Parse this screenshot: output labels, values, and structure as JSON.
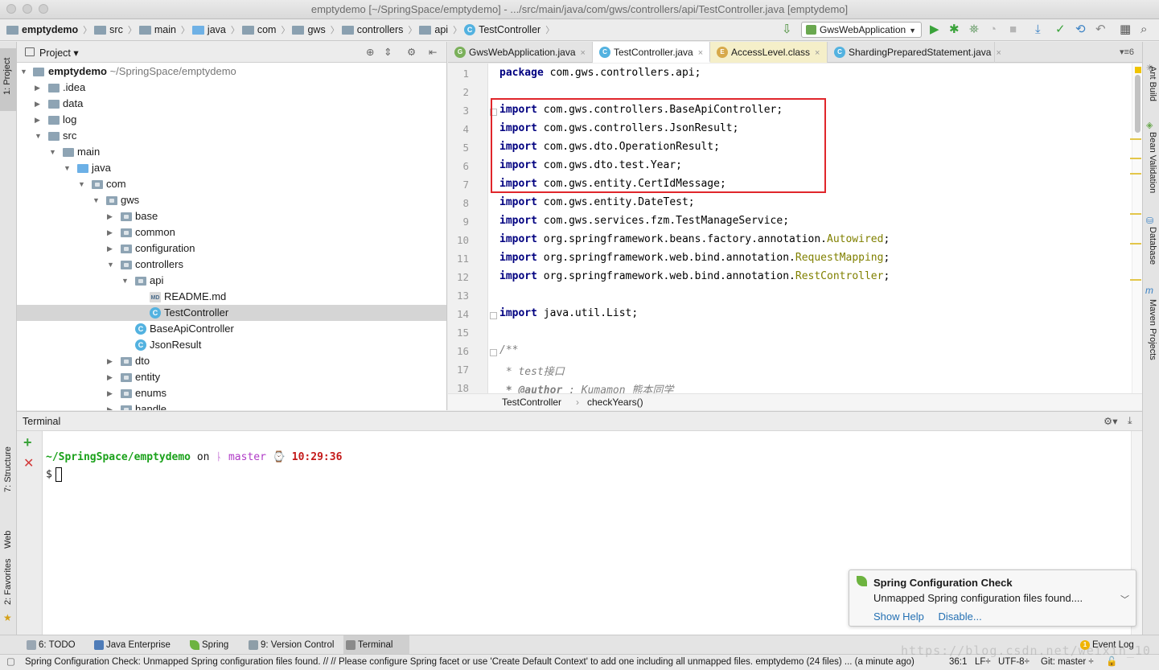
{
  "window": {
    "title": "emptydemo [~/SpringSpace/emptydemo] - .../src/main/java/com/gws/controllers/api/TestController.java [emptydemo]"
  },
  "breadcrumbs": [
    "emptydemo",
    "src",
    "main",
    "java",
    "com",
    "gws",
    "controllers",
    "api",
    "TestController"
  ],
  "run_config": "GwsWebApplication",
  "left_strip": {
    "project": "1: Project",
    "structure": "7: Structure",
    "web": "Web",
    "favorites": "2: Favorites"
  },
  "right_strip": {
    "ant": "Ant Build",
    "bean": "Bean Validation",
    "database": "Database",
    "maven": "Maven Projects"
  },
  "project": {
    "header": "Project",
    "root_name": "emptydemo",
    "root_path": "~/SpringSpace/emptydemo",
    "items": [
      ".idea",
      "data",
      "log",
      "src",
      "main",
      "java",
      "com",
      "gws",
      "base",
      "common",
      "configuration",
      "controllers",
      "api",
      "README.md",
      "TestController",
      "BaseApiController",
      "JsonResult",
      "dto",
      "entity",
      "enums",
      "handle"
    ]
  },
  "tabs": [
    {
      "label": "GwsWebApplication.java"
    },
    {
      "label": "TestController.java"
    },
    {
      "label": "AccessLevel.class"
    },
    {
      "label": "ShardingPreparedStatement.java"
    }
  ],
  "code": {
    "line_numbers": [
      "1",
      "2",
      "3",
      "4",
      "5",
      "6",
      "7",
      "8",
      "9",
      "10",
      "11",
      "12",
      "13",
      "14",
      "15",
      "16",
      "17",
      "18"
    ],
    "package_kw": "package",
    "package_name": " com.gws.controllers.api;",
    "import_kw": "import",
    "imports": [
      " com.gws.controllers.BaseApiController;",
      " com.gws.controllers.JsonResult;",
      " com.gws.dto.OperationResult;",
      " com.gws.dto.test.Year;",
      " com.gws.entity.CertIdMessage;",
      " com.gws.entity.DateTest;",
      " com.gws.services.fzm.TestManageService;"
    ],
    "spring_imports": [
      {
        "prefix": " org.springframework.beans.factory.annotation.",
        "name": "Autowired",
        "suffix": ";"
      },
      {
        "prefix": " org.springframework.web.bind.annotation.",
        "name": "RequestMapping",
        "suffix": ";"
      },
      {
        "prefix": " org.springframework.web.bind.annotation.",
        "name": "RestController",
        "suffix": ";"
      }
    ],
    "util_import": " java.util.List;",
    "doc_open": "/**",
    "doc_line1": " * test接口",
    "doc_line2_tag": " * @author",
    "doc_line2_rest": " : Kumamon 熊本同学"
  },
  "editor_breadcrumb": {
    "class_name": "TestController",
    "method_name": "checkYears()"
  },
  "terminal": {
    "header": "Terminal",
    "path": "~/SpringSpace/emptydemo",
    "on": "on",
    "branch_glyph": "ᚿ",
    "branch": "master",
    "time": "10:29:36",
    "prompt": "$"
  },
  "notification": {
    "title": "Spring Configuration Check",
    "body": "Unmapped Spring configuration files found....",
    "links": [
      "Show Help",
      "Disable..."
    ]
  },
  "bottom_tabs": [
    {
      "label": "6: TODO"
    },
    {
      "label": "Java Enterprise"
    },
    {
      "label": "Spring"
    },
    {
      "label": "9: Version Control"
    },
    {
      "label": "Terminal"
    }
  ],
  "event_log": "Event Log",
  "event_count": "1",
  "status": {
    "message": "Spring Configuration Check: Unmapped Spring configuration files found. // // Please configure Spring facet or use 'Create Default Context' to add one including all unmapped files. emptydemo (24 files)  ... (a minute ago)",
    "position": "36:1",
    "line_sep": "LF",
    "encoding": "UTF-8",
    "vcs": "Git: master"
  },
  "watermark": "https://blog.csdn.net/weixin_10"
}
